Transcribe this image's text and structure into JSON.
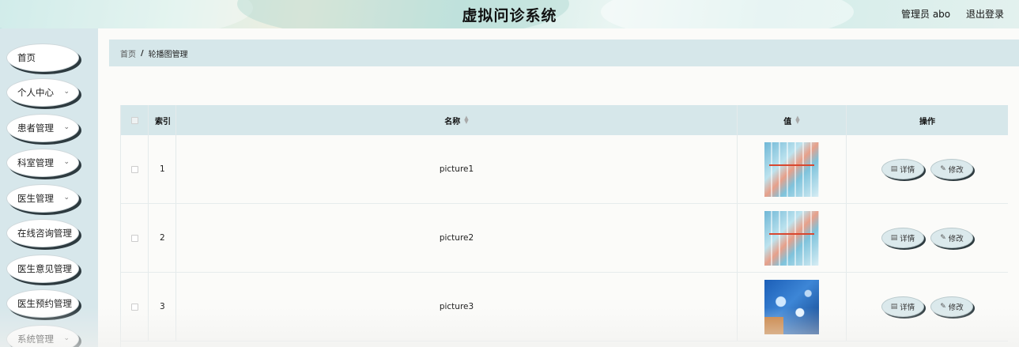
{
  "header": {
    "title": "虚拟问诊系统",
    "user_label": "管理员 abo",
    "logout_label": "退出登录"
  },
  "sidebar": {
    "items": [
      {
        "label": "首页",
        "has_chevron": false
      },
      {
        "label": "个人中心",
        "has_chevron": true
      },
      {
        "label": "患者管理",
        "has_chevron": true
      },
      {
        "label": "科室管理",
        "has_chevron": true
      },
      {
        "label": "医生管理",
        "has_chevron": true
      },
      {
        "label": "在线咨询管理",
        "has_chevron": false
      },
      {
        "label": "医生意见管理",
        "has_chevron": false
      },
      {
        "label": "医生预约管理",
        "has_chevron": false
      },
      {
        "label": "系统管理",
        "has_chevron": true
      }
    ]
  },
  "breadcrumb": {
    "home": "首页",
    "separator": "/",
    "current": "轮播图管理"
  },
  "table": {
    "columns": {
      "index": "索引",
      "name": "名称",
      "value": "值",
      "ops": "操作"
    },
    "rows": [
      {
        "index": "1",
        "name": "picture1",
        "thumb": "thumb-a"
      },
      {
        "index": "2",
        "name": "picture2",
        "thumb": "thumb-a"
      },
      {
        "index": "3",
        "name": "picture3",
        "thumb": "thumb-b"
      }
    ],
    "detail_label": "详情",
    "edit_label": "修改"
  }
}
